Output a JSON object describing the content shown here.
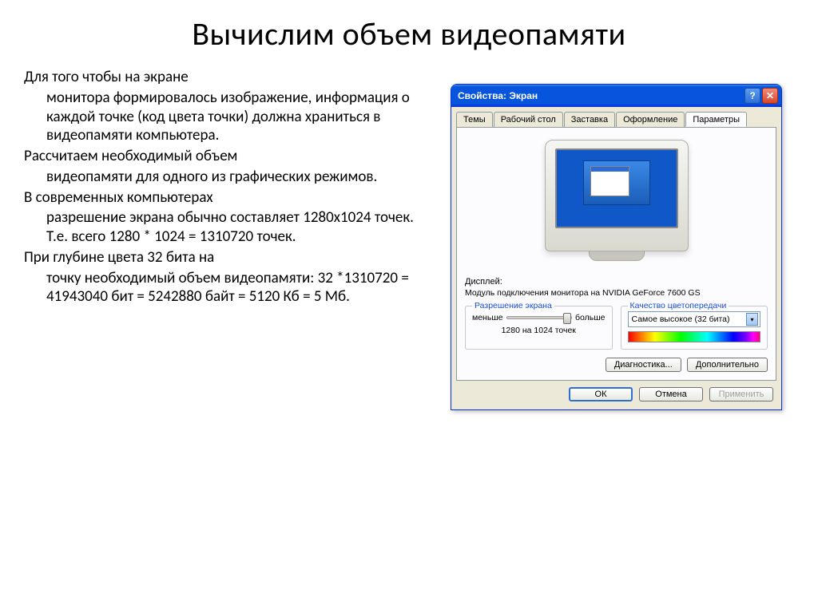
{
  "slide": {
    "title": "Вычислим объем видеопамяти",
    "para1_a": "Для того чтобы на экране",
    "para1_b": "монитора формировалось изображение, информация о каждой точке (код цвета точки) должна храниться в видеопамяти компьютера.",
    "para2_a": "Рассчитаем необходимый объем",
    "para2_b": "видеопамяти для одного из графических режимов.",
    "para3_a": "В современных компьютерах",
    "para3_b": "разрешение экрана обычно составляет 1280х1024 точек. Т.е. всего 1280 * 1024 = 1310720 точек.",
    "para4_a": "При глубине цвета 32 бита на",
    "para4_b": "точку необходимый объем видеопамяти: 32 *1310720 = 41943040 бит = 5242880 байт = 5120 Кб = 5 Мб."
  },
  "dialog": {
    "title": "Свойства: Экран",
    "help": "?",
    "close": "✕",
    "tabs": {
      "themes": "Темы",
      "desktop": "Рабочий стол",
      "screensaver": "Заставка",
      "appearance": "Оформление",
      "settings": "Параметры"
    },
    "display_label": "Дисплей:",
    "display_name": "Модуль подключения монитора на NVIDIA GeForce 7600 GS",
    "resolution": {
      "legend": "Разрешение экрана",
      "less": "меньше",
      "more": "больше",
      "value": "1280 на 1024 точек"
    },
    "quality": {
      "legend": "Качество цветопередачи",
      "value": "Самое высокое (32 бита)"
    },
    "buttons": {
      "diagnostics": "Диагностика...",
      "advanced": "Дополнительно",
      "ok": "ОК",
      "cancel": "Отмена",
      "apply": "Применить"
    }
  }
}
